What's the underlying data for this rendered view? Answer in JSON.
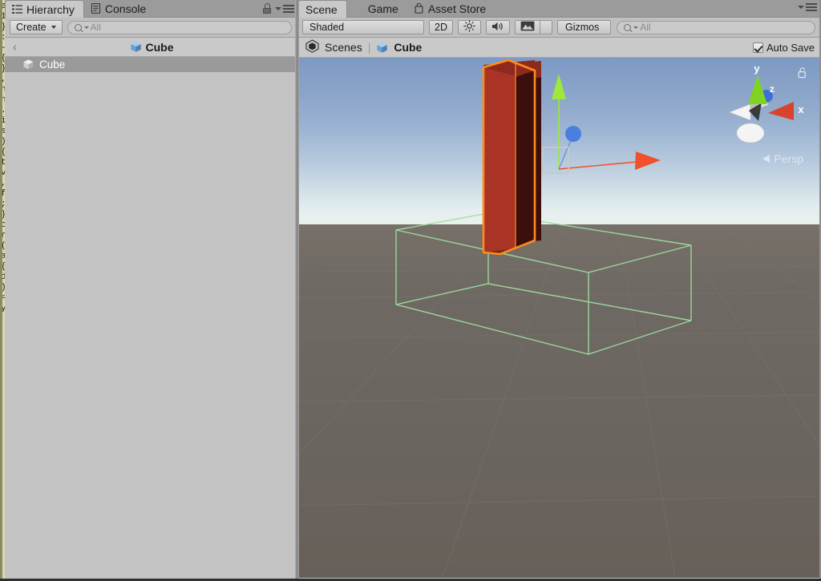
{
  "app": {
    "name": "Unity Editor",
    "theme": "light"
  },
  "background_window": {
    "kind": "code-editor-sliver",
    "bg_color": "#ddd9a8",
    "lines": [
      "e",
      "1,",
      "}",
      ":",
      "-",
      "{",
      "}",
      ",",
      "n",
      "n",
      ".",
      "i",
      "s",
      ")",
      "{",
      "t",
      "v",
      ",",
      "f",
      ";",
      "}",
      "c",
      "r",
      "(",
      "a",
      "{",
      "d",
      ")",
      "=",
      "y"
    ]
  },
  "hierarchy": {
    "tabs": [
      {
        "label": "Hierarchy",
        "icon": "hierarchy-list-icon",
        "active": true
      },
      {
        "label": "Console",
        "icon": "console-icon",
        "active": false
      }
    ],
    "window_menu": {
      "lock_icon": "lock-icon",
      "menu_icon": "hamburger-menu-icon"
    },
    "toolbar": {
      "create_label": "Create",
      "search": {
        "placeholder": "All",
        "value": "",
        "icon": "search-icon"
      }
    },
    "breadcrumb": {
      "back_glyph": "‹",
      "title": "Cube",
      "icon": "cube-icon-blue"
    },
    "items": [
      {
        "label": "Cube",
        "icon": "cube-icon-grey",
        "selected": true,
        "depth": 0
      }
    ]
  },
  "scene": {
    "tabs": [
      {
        "label": "Scene",
        "icon": "",
        "active": true
      },
      {
        "label": "Game",
        "icon": "game-icon",
        "active": false
      },
      {
        "label": "Asset Store",
        "icon": "asset-store-icon",
        "active": false
      }
    ],
    "window_menu": {
      "menu_icon": "hamburger-menu-icon"
    },
    "toolbar": {
      "draw_mode": {
        "label": "Shaded",
        "icon": "chevron-down-icon"
      },
      "mode_2d": {
        "label": "2D",
        "active": false
      },
      "lighting": {
        "label": "",
        "icon": "sun-lighting-icon"
      },
      "audio": {
        "label": "",
        "icon": "audio-speaker-icon"
      },
      "fx": {
        "label": "",
        "icon": "image-fx-icon",
        "dropdown_icon": "chevron-down-icon"
      },
      "gizmos": {
        "label": "Gizmos",
        "icon": "chevron-down-icon"
      },
      "search": {
        "placeholder": "All",
        "value": "",
        "icon": "search-icon"
      }
    },
    "breadcrumb": {
      "scenes_label": "Scenes",
      "scenes_icon": "unity-logo-icon",
      "separator": "|",
      "object_label": "Cube",
      "object_icon": "cube-icon-blue"
    },
    "auto_save": {
      "label": "Auto Save",
      "checked": true
    },
    "viewport": {
      "projection_label": "Persp",
      "projection_arrow": "left-arrow-icon",
      "lock_icon": "unlock-icon",
      "axis_gizmo": {
        "axes": [
          {
            "name": "y",
            "label": "y",
            "color": "#8fd63a",
            "direction": "up"
          },
          {
            "name": "z",
            "label": "z",
            "color": "#3f6fd6",
            "direction": "back"
          },
          {
            "name": "x",
            "label": "x",
            "color": "#d9422b",
            "direction": "right"
          },
          {
            "name": "-x",
            "label": "",
            "color": "#f4f4f4",
            "direction": "left"
          },
          {
            "name": "-y",
            "label": "",
            "color": "#f4f4f4",
            "direction": "down"
          },
          {
            "name": "-z",
            "label": "",
            "color": "#3a3a3a",
            "direction": "front"
          }
        ]
      },
      "sky": {
        "top_color": "#7d9ac4",
        "horizon_color": "#eaf0ee"
      },
      "ground_color": "#6d6763",
      "selected_object": {
        "name": "Cube",
        "shape": "tall-box",
        "fill_color": "#a93426",
        "shade_color": "#3b100c",
        "outline_color": "#ff8c1a"
      },
      "collider_bounds": {
        "color": "#9fe09f",
        "label": "box-collider-wireframe"
      },
      "move_gizmo": {
        "y_axis_color": "#9ee83c",
        "x_axis_color": "#f0512a",
        "z_handle_color": "#4a7fe0",
        "plane_handle_color": "#c8c8c8"
      }
    }
  }
}
